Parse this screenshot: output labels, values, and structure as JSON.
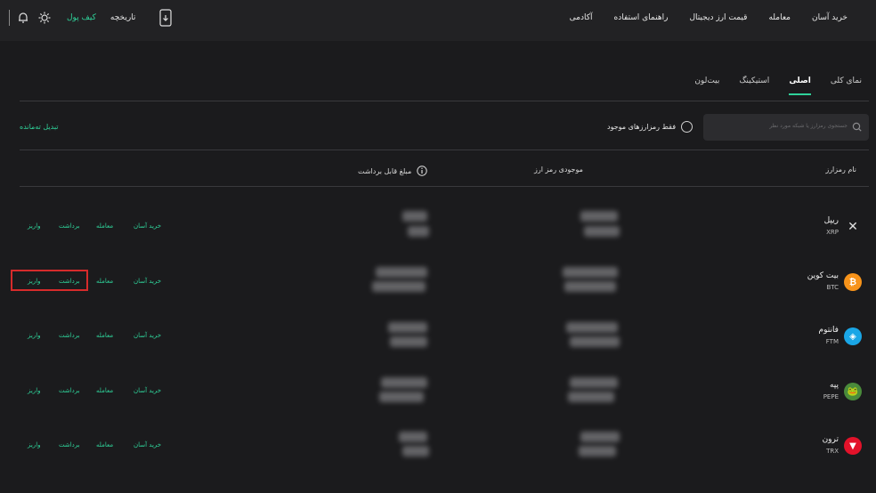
{
  "nav": {
    "items": [
      "خرید آسان",
      "معامله",
      "قیمت ارز دیجیتال",
      "راهنمای استفاده",
      "آکادمی"
    ],
    "wallet": "کیف پول",
    "history": "تاریخچه"
  },
  "tabs": [
    "نمای کلی",
    "اصلی",
    "استیکینگ",
    "بیت‌لون"
  ],
  "active_tab": "اصلی",
  "search": {
    "placeholder": "جستجوی رمزارز یا شبکه مورد نظر"
  },
  "filter_label": "فقط رمزارزهای موجود",
  "convert_label": "تبدیل ته‌مانده",
  "columns": {
    "name": "نام رمزارز",
    "balance": "موجودی رمز ارز",
    "withdrawable": "مبلغ قابل برداشت"
  },
  "actions": {
    "buy": "خرید آسان",
    "trade": "معامله",
    "withdraw": "برداشت",
    "deposit": "واریز"
  },
  "coins": [
    {
      "name": "ریپل",
      "symbol": "XRP",
      "icon": "xrp-icon",
      "color": "#2a2a2c"
    },
    {
      "name": "بیت کوین",
      "symbol": "BTC",
      "icon": "btc-icon",
      "color": "#f7931a"
    },
    {
      "name": "فانتوم",
      "symbol": "FTM",
      "icon": "ftm-icon",
      "color": "#1aa6e6"
    },
    {
      "name": "پپه",
      "symbol": "PEPE",
      "icon": "pepe-icon",
      "color": "#4a8b3b"
    },
    {
      "name": "ترون",
      "symbol": "TRX",
      "icon": "trx-icon",
      "color": "#e3122a"
    }
  ],
  "colors": {
    "accent": "#2fd39a",
    "highlight": "#d62b2b"
  }
}
